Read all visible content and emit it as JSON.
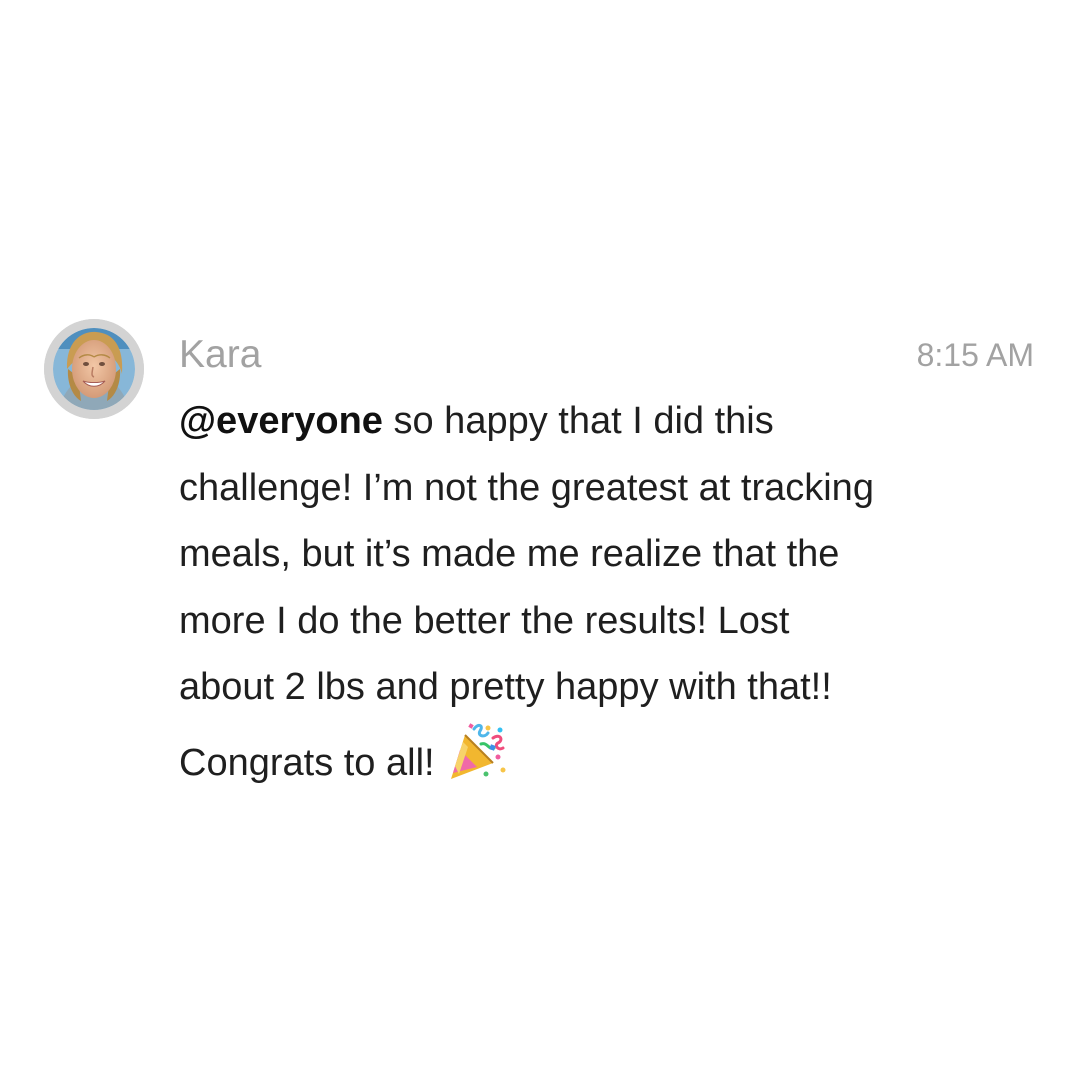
{
  "message": {
    "author": "Kara",
    "timestamp": "8:15 AM",
    "mention": "@everyone",
    "body_lines": [
      " so happy that I did this",
      "challenge! I’m not the greatest at tracking",
      "meals, but it’s made me realize that the",
      "more I do the better the results! Lost",
      "about 2 lbs and pretty happy with that!!",
      "Congrats to all!"
    ],
    "emoji": "party-popper-icon"
  },
  "colors": {
    "background": "#ffffff",
    "meta_text": "#a2a2a2",
    "body_text": "#1f1f1f",
    "mention_text": "#111111",
    "avatar_ring": "#d3d3d3"
  },
  "avatar": {
    "icon": "profile-photo"
  }
}
